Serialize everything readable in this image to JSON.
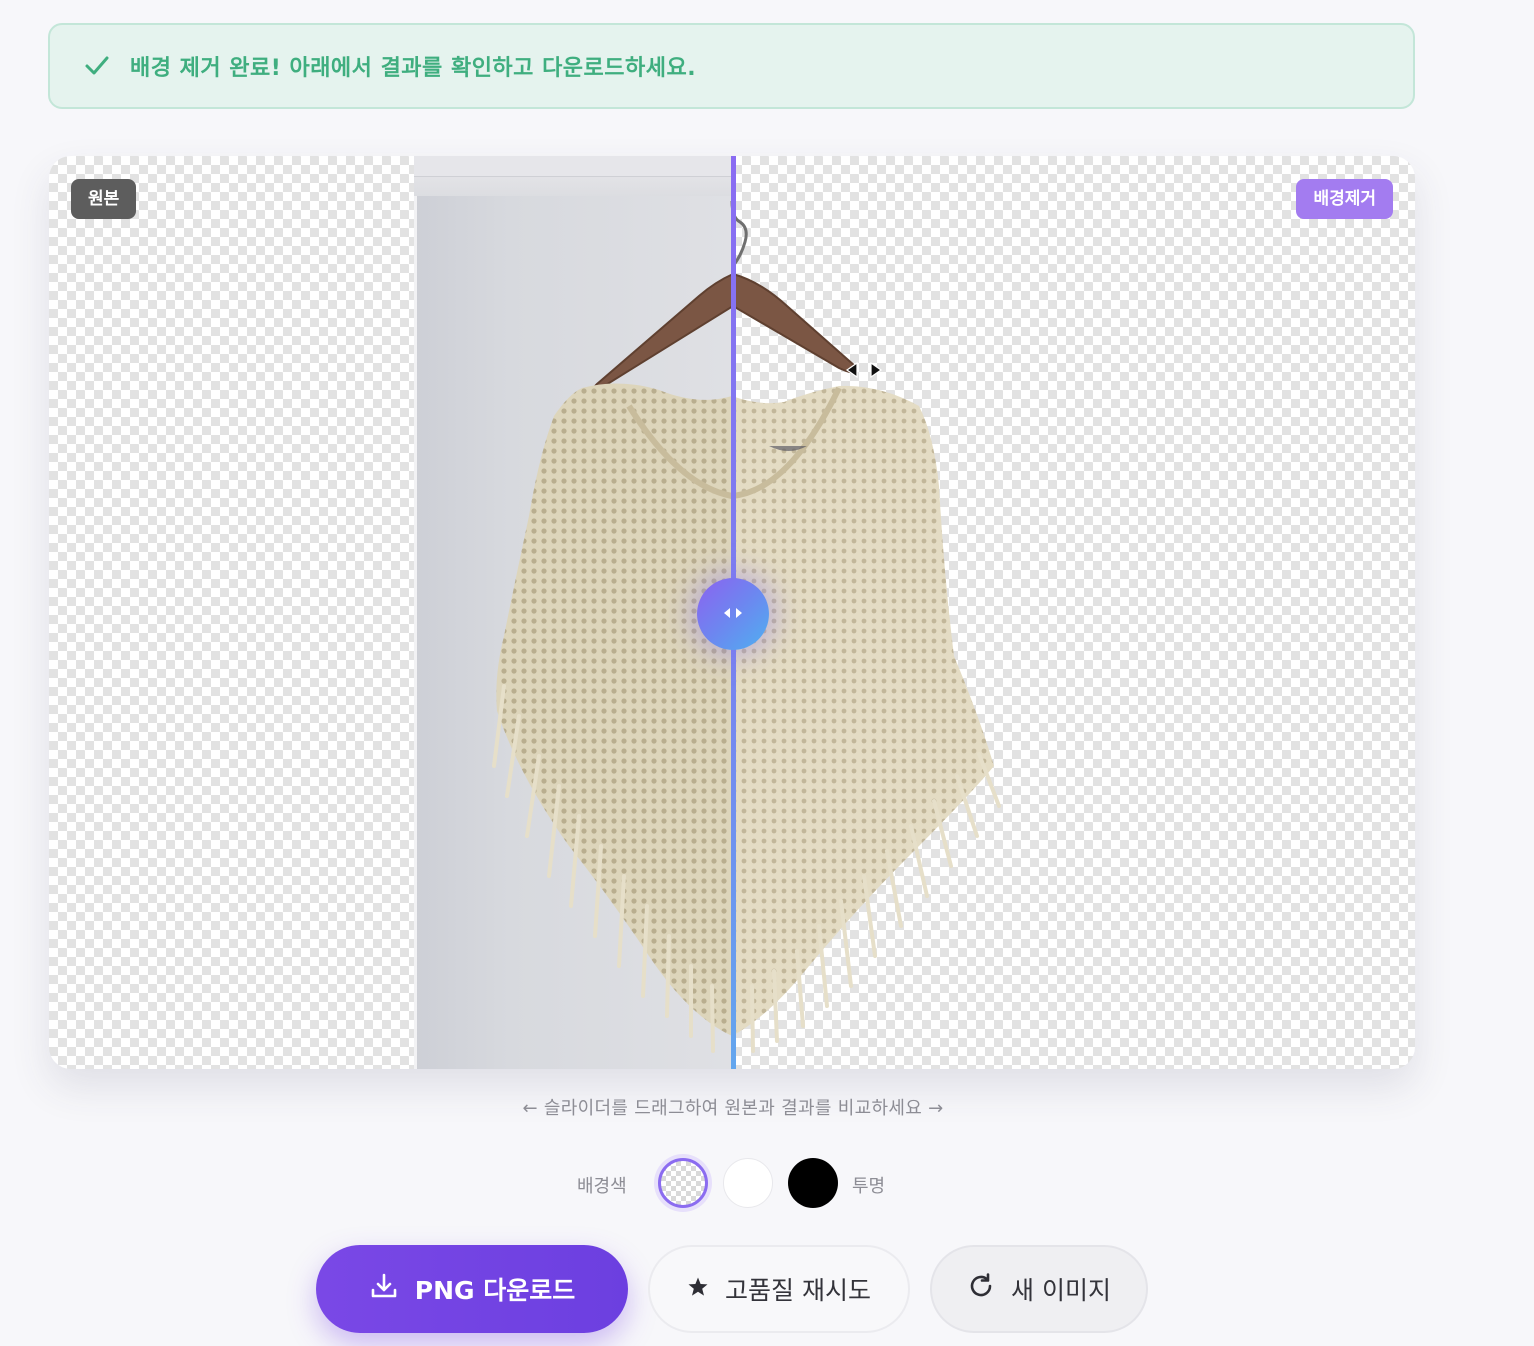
{
  "banner": {
    "message": "배경 제거 완료! 아래에서 결과를 확인하고 다운로드하세요.",
    "icon": "check-icon",
    "color": "#3fae7f"
  },
  "compare": {
    "label_original": "원본",
    "label_result": "배경제거",
    "slider_position_fraction": 0.5,
    "handle_icon": "left-right-arrows-icon"
  },
  "hint": "← 슬라이더를 드래그하여 원본과 결과를 비교하세요 →",
  "background_picker": {
    "label": "배경색",
    "options": [
      {
        "name": "transparent",
        "selected": true
      },
      {
        "name": "white",
        "color": "#ffffff",
        "selected": false
      },
      {
        "name": "black",
        "color": "#000000",
        "selected": false
      }
    ],
    "selected_label": "투명"
  },
  "actions": {
    "download": {
      "label": "PNG 다운로드",
      "icon": "download-icon"
    },
    "retry": {
      "label": "고품질 재시도",
      "icon": "star-icon"
    },
    "new_image": {
      "label": "새 이미지",
      "icon": "refresh-icon"
    }
  },
  "colors": {
    "accent": "#7a48e6",
    "result_badge": "#a37cf0",
    "original_badge": "#5d5d5d",
    "success_bg": "#e5f3ee"
  }
}
